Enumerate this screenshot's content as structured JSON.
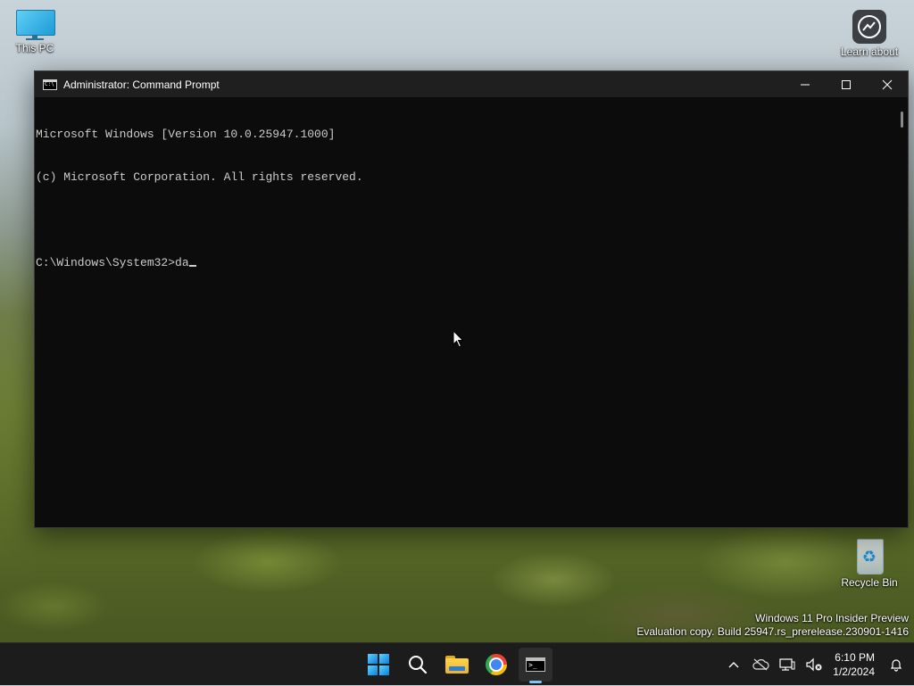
{
  "desktop": {
    "icons": [
      {
        "label": "This PC"
      },
      {
        "label": "Learn about"
      },
      {
        "label": "Recycle Bin"
      }
    ],
    "watermark": {
      "line1": "Windows 11 Pro Insider Preview",
      "line2": "Evaluation copy. Build 25947.rs_prerelease.230901-1416"
    }
  },
  "window": {
    "title": "Administrator: Command Prompt",
    "controls": {
      "minimize": "—",
      "maximize": "☐",
      "close": "✕"
    },
    "console": {
      "lines": [
        "Microsoft Windows [Version 10.0.25947.1000]",
        "(c) Microsoft Corporation. All rights reserved.",
        "",
        "C:\\Windows\\System32>da"
      ]
    }
  },
  "taskbar": {
    "apps": [
      {
        "name": "start-icon"
      },
      {
        "name": "search-icon"
      },
      {
        "name": "file-explorer-icon"
      },
      {
        "name": "chrome-icon"
      },
      {
        "name": "command-prompt-icon",
        "active": true
      }
    ],
    "tray": {
      "chevron": "^",
      "time": "6:10 PM",
      "date": "1/2/2024"
    }
  },
  "colors": {
    "console_bg": "#0c0c0c",
    "console_fg": "#cccccc",
    "titlebar_bg": "#1f1f1f",
    "taskbar_bg": "#1c1c1c",
    "accent": "#7fc5f5"
  }
}
